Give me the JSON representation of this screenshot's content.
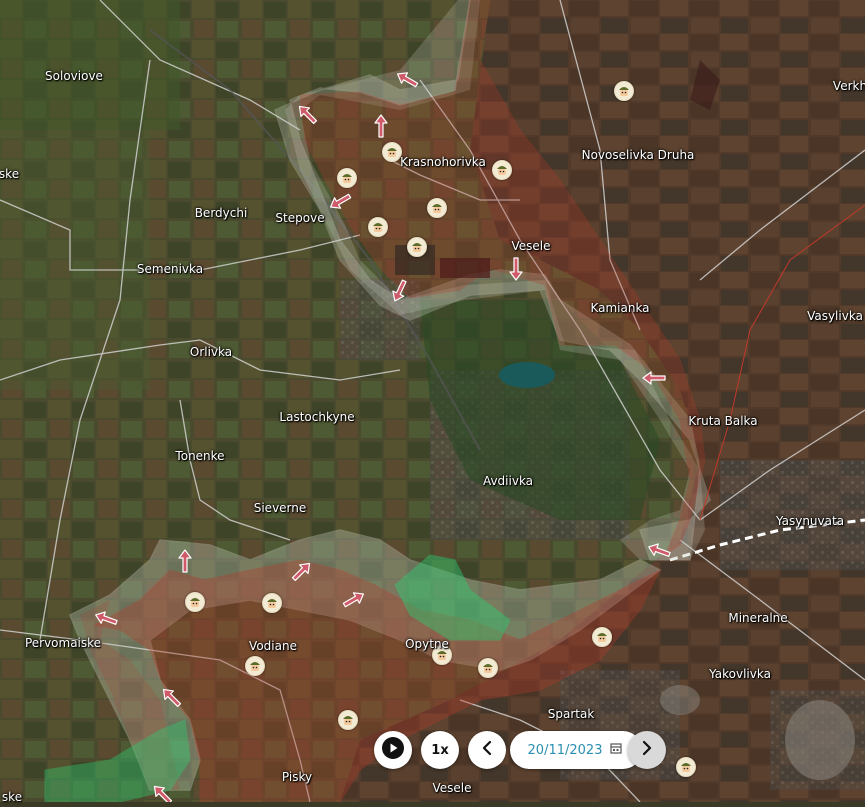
{
  "map": {
    "places": [
      "Soloviove",
      "ske",
      "Berdychi",
      "Stepove",
      "Semenivka",
      "Orlivka",
      "Lastochkyne",
      "Tonenke",
      "Sieverne",
      "Avdiivka",
      "Krasnohorivka",
      "Novoselivka Druha",
      "Vesele",
      "Kamianka",
      "Kruta Balka",
      "Vasylivka",
      "Verkh",
      "Yasynuvata",
      "Mineralne",
      "Yakovlivka",
      "Pervomaiske",
      "Vodiane",
      "Opytne",
      "Spartak",
      "Pisky",
      "Vesele",
      "ske"
    ],
    "colors": {
      "occupied_fill": "#b33a2a",
      "occupied_border": "#c0392b",
      "gray_zone": "#c9d2c4",
      "liberated_fill": "#2ecc71",
      "arrow": "#cf5b6a",
      "unit_icon": "#f2ead2"
    }
  },
  "controls": {
    "play_icon": "play-icon",
    "speed": "1x",
    "prev_icon": "chevron-left-icon",
    "date": "20/11/2023",
    "calendar_icon": "calendar-icon",
    "next_icon": "chevron-right-icon"
  }
}
